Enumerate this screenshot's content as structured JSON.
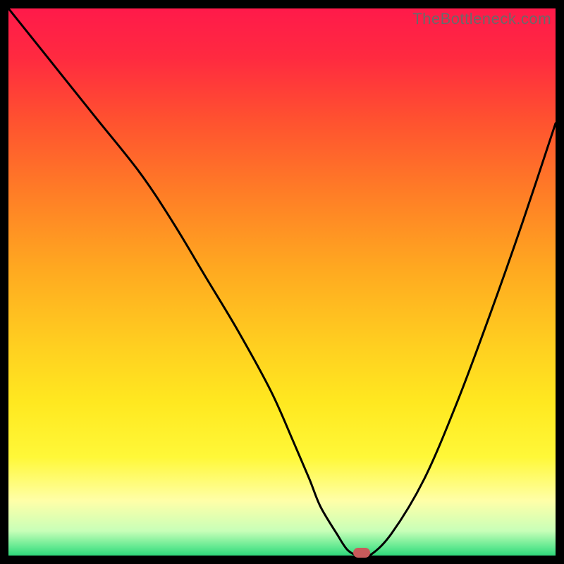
{
  "watermark": "TheBottleneck.com",
  "gradient_stops": [
    {
      "offset": 0.0,
      "color": "#ff1a4a"
    },
    {
      "offset": 0.09,
      "color": "#ff2a40"
    },
    {
      "offset": 0.2,
      "color": "#ff5030"
    },
    {
      "offset": 0.34,
      "color": "#ff7e26"
    },
    {
      "offset": 0.48,
      "color": "#ffaa20"
    },
    {
      "offset": 0.62,
      "color": "#ffd020"
    },
    {
      "offset": 0.72,
      "color": "#ffe820"
    },
    {
      "offset": 0.82,
      "color": "#fff838"
    },
    {
      "offset": 0.9,
      "color": "#ffffa8"
    },
    {
      "offset": 0.955,
      "color": "#c8ffb8"
    },
    {
      "offset": 0.985,
      "color": "#60e890"
    },
    {
      "offset": 1.0,
      "color": "#30d87a"
    }
  ],
  "chart_data": {
    "type": "line",
    "title": "",
    "xlabel": "",
    "ylabel": "",
    "xlim": [
      0,
      100
    ],
    "ylim": [
      0,
      100
    ],
    "series": [
      {
        "name": "bottleneck-curve",
        "x": [
          0,
          8,
          16,
          24,
          30,
          36,
          42,
          48,
          52,
          55,
          57,
          60,
          62,
          64,
          66,
          70,
          76,
          82,
          88,
          94,
          100
        ],
        "y": [
          100,
          90,
          80,
          70,
          61,
          51,
          41,
          30,
          21,
          14,
          9,
          4,
          1,
          0,
          0,
          4,
          14,
          28,
          44,
          61,
          79
        ]
      }
    ],
    "marker": {
      "x": 64.5,
      "y": 0.5,
      "color": "#c85a5a"
    }
  }
}
